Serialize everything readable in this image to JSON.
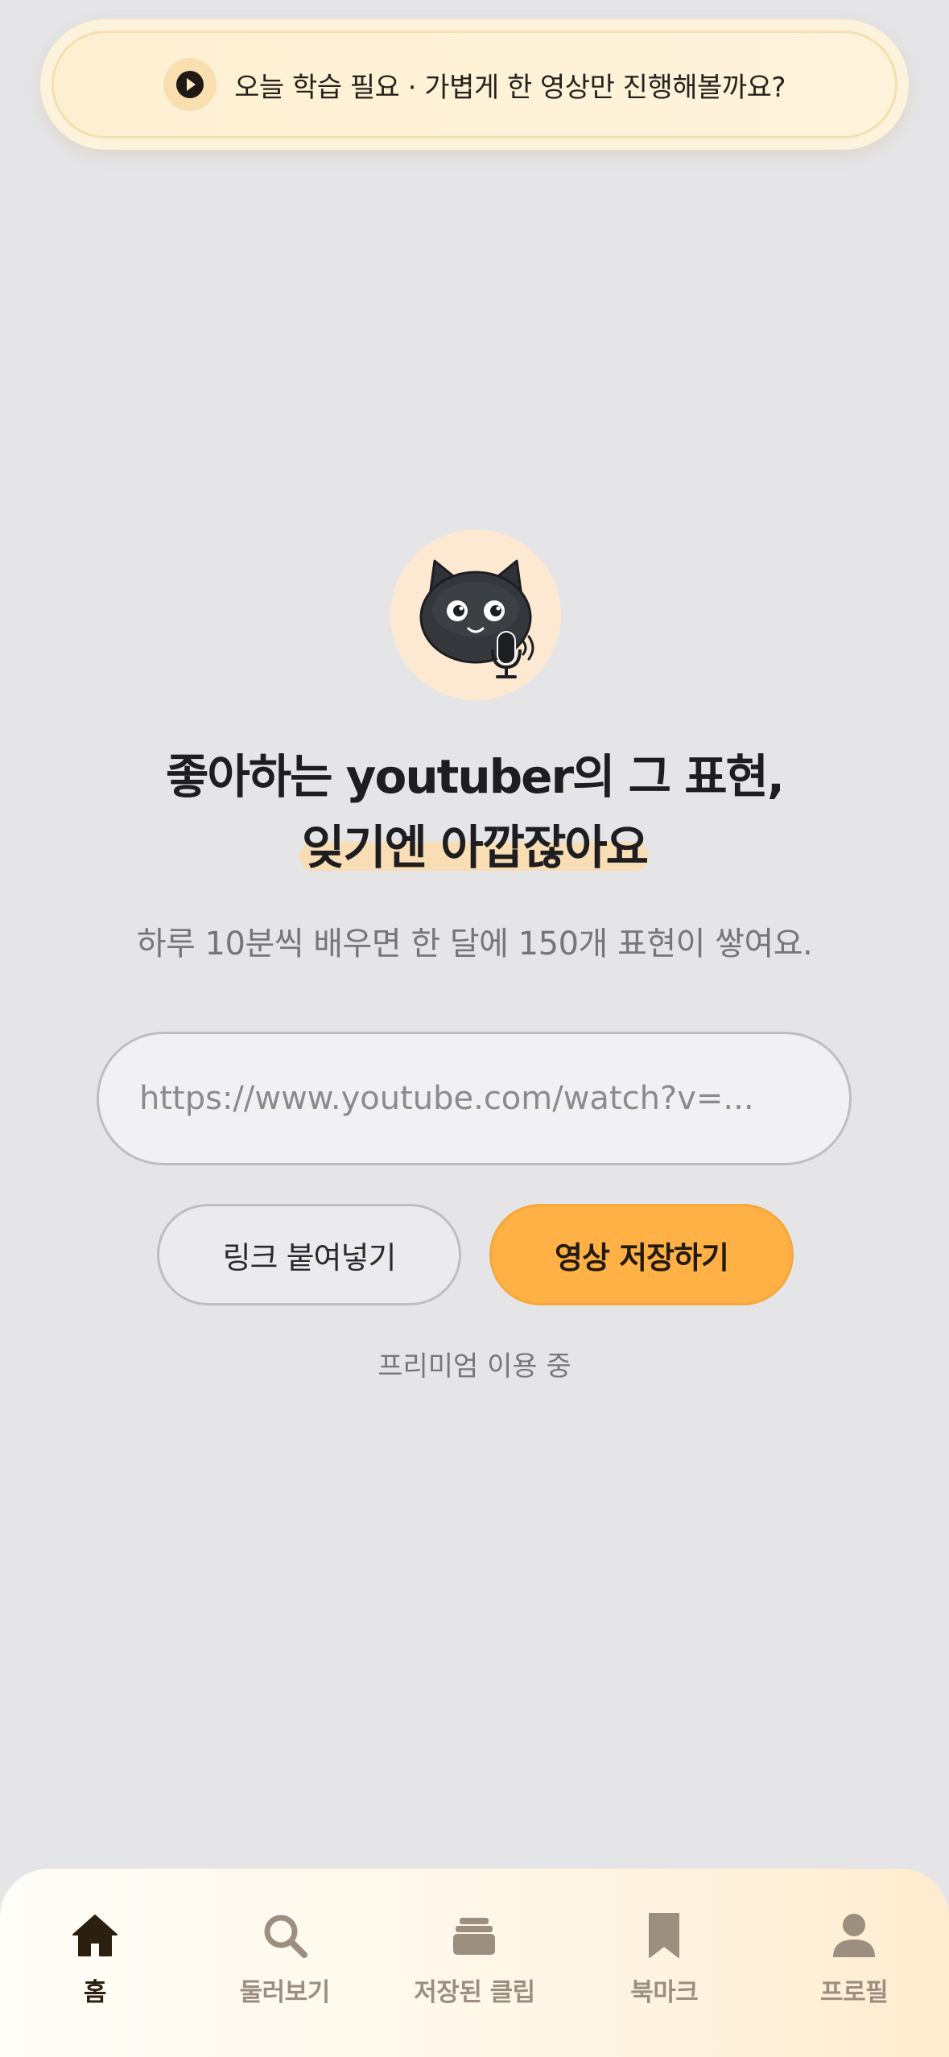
{
  "banner": {
    "icon": "play-icon",
    "text": "오늘 학습 필요 · 가볍게 한 영상만 진행해볼까요?"
  },
  "hero": {
    "mascot": "cat-with-microphone-icon",
    "headline_line1": "좋아하는 youtuber의 그 표현,",
    "headline_line2": "잊기엔 아깝잖아요",
    "subline": "하루 10분씩 배우면 한 달에 150개 표현이 쌓여요."
  },
  "url_input": {
    "placeholder": "https://www.youtube.com/watch?v=...",
    "value": ""
  },
  "actions": {
    "paste_label": "링크 붙여넣기",
    "save_label": "영상 저장하기"
  },
  "status": {
    "premium_text": "프리미엄 이용 중"
  },
  "bottom_nav": {
    "items": [
      {
        "label": "홈",
        "icon": "home-icon",
        "active": true
      },
      {
        "label": "둘러보기",
        "icon": "search-icon",
        "active": false
      },
      {
        "label": "저장된 클립",
        "icon": "stack-icon",
        "active": false
      },
      {
        "label": "북마크",
        "icon": "bookmark-icon",
        "active": false
      },
      {
        "label": "프로필",
        "icon": "person-icon",
        "active": false
      }
    ]
  },
  "colors": {
    "accent": "#ffb145",
    "banner_bg": "#fdf0d2",
    "background": "#e5e5e7",
    "nav_active": "#2b1f10",
    "nav_inactive": "#9c8f80"
  }
}
